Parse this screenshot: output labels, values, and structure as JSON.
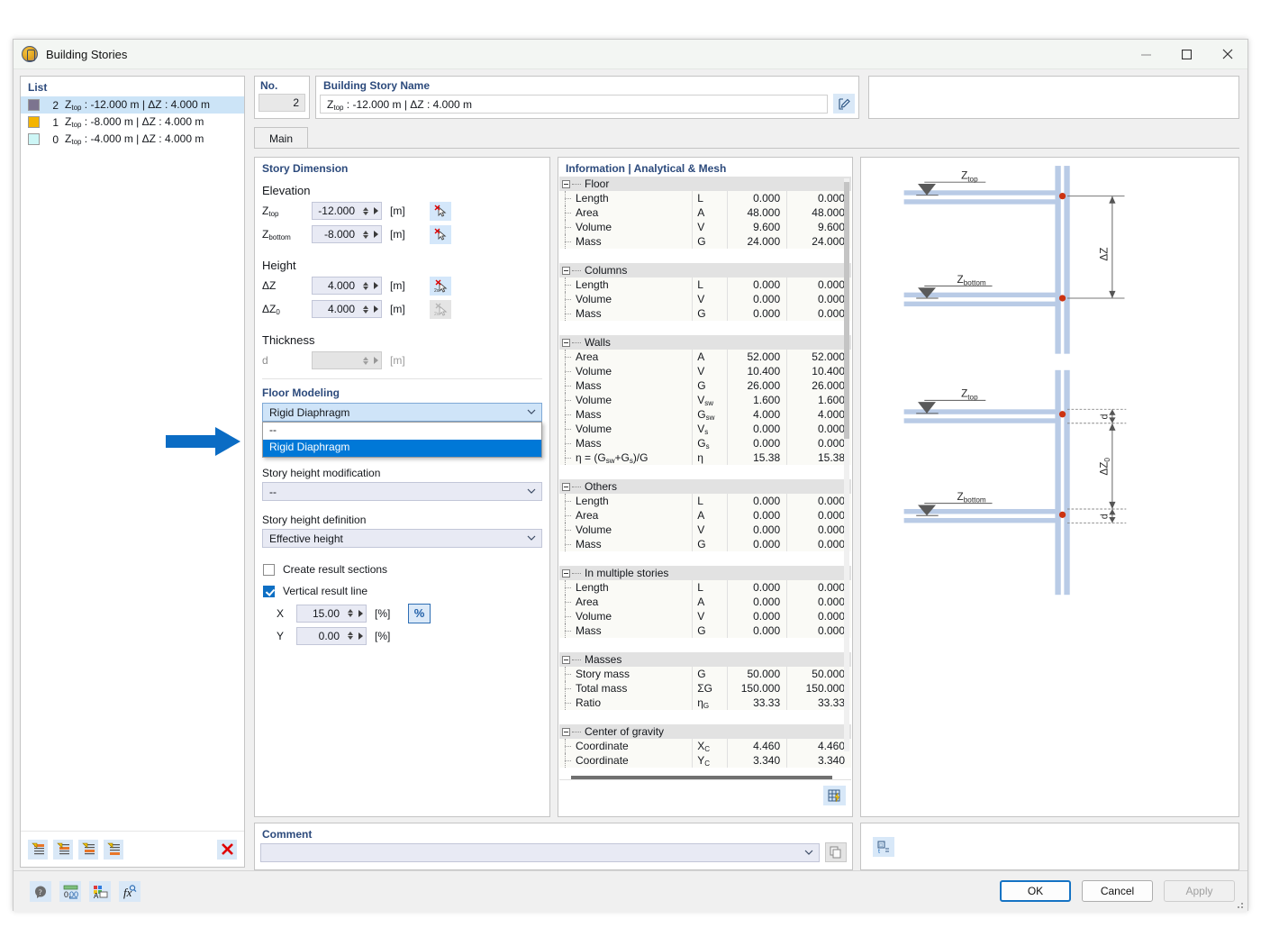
{
  "window": {
    "title": "Building Stories",
    "icon": "building-stories-icon",
    "minimize": "–",
    "maximize": "□",
    "close": "✕"
  },
  "list": {
    "header": "List",
    "items": [
      {
        "color": "#7c748f",
        "num": "2",
        "text": "Ztop : -12.000 m | ΔZ : 4.000 m",
        "selected": true
      },
      {
        "color": "#f4b400",
        "num": "1",
        "text": "Ztop : -8.000 m | ΔZ : 4.000 m",
        "selected": false
      },
      {
        "color": "#cdf6f6",
        "num": "0",
        "text": "Ztop : -4.000 m | ΔZ : 4.000 m",
        "selected": false
      }
    ],
    "toolbar": [
      {
        "name": "insert-story-above-icon"
      },
      {
        "name": "insert-story-below-icon"
      },
      {
        "name": "insert-story-middle-icon"
      },
      {
        "name": "insert-story-bottom-icon"
      },
      {
        "name": "delete-icon"
      }
    ]
  },
  "header": {
    "no_label": "No.",
    "no_value": "2",
    "name_label": "Building Story Name",
    "name_value": "Ztop : -12.000 m | ΔZ : 4.000 m",
    "edit_icon": "edit-pencil-icon"
  },
  "tabs": [
    {
      "label": "Main",
      "active": true
    }
  ],
  "story_dimension": {
    "title": "Story Dimension",
    "elevation_label": "Elevation",
    "height_label": "Height",
    "thickness_label": "Thickness",
    "fields": [
      {
        "name": "Ztop",
        "sub": "top",
        "value": "-12.000",
        "unit": "[m]",
        "enabled": true,
        "pick": "pick-point-icon"
      },
      {
        "name": "Zbottom",
        "sub": "bottom",
        "value": "-8.000",
        "unit": "[m]",
        "enabled": true,
        "pick": "pick-point-icon"
      },
      {
        "name": "ΔZ",
        "sub": "",
        "value": "4.000",
        "unit": "[m]",
        "enabled": true,
        "pick": "pick-distance-icon"
      },
      {
        "name": "ΔZ0",
        "sub": "0",
        "value": "4.000",
        "unit": "[m]",
        "enabled": true,
        "pick": "pick-distance-icon-disabled"
      },
      {
        "name": "d",
        "sub": "",
        "value": "",
        "unit": "[m]",
        "enabled": false,
        "pick": ""
      }
    ]
  },
  "floor_modeling": {
    "title": "Floor Modeling",
    "type_value": "Rigid Diaphragm",
    "dropdown_open": true,
    "dropdown_options": [
      "--",
      "Rigid Diaphragm"
    ],
    "dropdown_selected": "Rigid Diaphragm",
    "height_mod_label": "Story height modification",
    "height_mod_value": "--",
    "height_def_label": "Story height definition",
    "height_def_value": "Effective height",
    "create_result_sections": {
      "label": "Create result sections",
      "checked": false
    },
    "vertical_result_line": {
      "label": "Vertical result line",
      "checked": true
    },
    "x": {
      "name": "X",
      "value": "15.00",
      "unit": "[%]"
    },
    "y": {
      "name": "Y",
      "value": "0.00",
      "unit": "[%]"
    },
    "percent_button": "%"
  },
  "information": {
    "title": "Information | Analytical & Mesh",
    "table_button_icon": "export-table-icon",
    "groups": [
      {
        "name": "Floor",
        "rows": [
          {
            "label": "Length",
            "symbol": "L",
            "sym_sub": "",
            "v1": "0.000",
            "v2": "0.000"
          },
          {
            "label": "Area",
            "symbol": "A",
            "sym_sub": "",
            "v1": "48.000",
            "v2": "48.000"
          },
          {
            "label": "Volume",
            "symbol": "V",
            "sym_sub": "",
            "v1": "9.600",
            "v2": "9.600"
          },
          {
            "label": "Mass",
            "symbol": "G",
            "sym_sub": "",
            "v1": "24.000",
            "v2": "24.000"
          }
        ]
      },
      {
        "name": "Columns",
        "rows": [
          {
            "label": "Length",
            "symbol": "L",
            "sym_sub": "",
            "v1": "0.000",
            "v2": "0.000"
          },
          {
            "label": "Volume",
            "symbol": "V",
            "sym_sub": "",
            "v1": "0.000",
            "v2": "0.000"
          },
          {
            "label": "Mass",
            "symbol": "G",
            "sym_sub": "",
            "v1": "0.000",
            "v2": "0.000"
          }
        ]
      },
      {
        "name": "Walls",
        "rows": [
          {
            "label": "Area",
            "symbol": "A",
            "sym_sub": "",
            "v1": "52.000",
            "v2": "52.000"
          },
          {
            "label": "Volume",
            "symbol": "V",
            "sym_sub": "",
            "v1": "10.400",
            "v2": "10.400"
          },
          {
            "label": "Mass",
            "symbol": "G",
            "sym_sub": "",
            "v1": "26.000",
            "v2": "26.000"
          },
          {
            "label": "Volume",
            "symbol": "V",
            "sym_sub": "sw",
            "v1": "1.600",
            "v2": "1.600"
          },
          {
            "label": "Mass",
            "symbol": "G",
            "sym_sub": "sw",
            "v1": "4.000",
            "v2": "4.000"
          },
          {
            "label": "Volume",
            "symbol": "V",
            "sym_sub": "s",
            "v1": "0.000",
            "v2": "0.000"
          },
          {
            "label": "Mass",
            "symbol": "G",
            "sym_sub": "s",
            "v1": "0.000",
            "v2": "0.000"
          },
          {
            "label": "η = (Gsw+Gs)/G",
            "symbol": "η",
            "sym_sub": "",
            "v1": "15.38",
            "v2": "15.38"
          }
        ]
      },
      {
        "name": "Others",
        "rows": [
          {
            "label": "Length",
            "symbol": "L",
            "sym_sub": "",
            "v1": "0.000",
            "v2": "0.000"
          },
          {
            "label": "Area",
            "symbol": "A",
            "sym_sub": "",
            "v1": "0.000",
            "v2": "0.000"
          },
          {
            "label": "Volume",
            "symbol": "V",
            "sym_sub": "",
            "v1": "0.000",
            "v2": "0.000"
          },
          {
            "label": "Mass",
            "symbol": "G",
            "sym_sub": "",
            "v1": "0.000",
            "v2": "0.000"
          }
        ]
      },
      {
        "name": "In multiple stories",
        "rows": [
          {
            "label": "Length",
            "symbol": "L",
            "sym_sub": "",
            "v1": "0.000",
            "v2": "0.000"
          },
          {
            "label": "Area",
            "symbol": "A",
            "sym_sub": "",
            "v1": "0.000",
            "v2": "0.000"
          },
          {
            "label": "Volume",
            "symbol": "V",
            "sym_sub": "",
            "v1": "0.000",
            "v2": "0.000"
          },
          {
            "label": "Mass",
            "symbol": "G",
            "sym_sub": "",
            "v1": "0.000",
            "v2": "0.000"
          }
        ]
      },
      {
        "name": "Masses",
        "rows": [
          {
            "label": "Story mass",
            "symbol": "G",
            "sym_sub": "",
            "v1": "50.000",
            "v2": "50.000"
          },
          {
            "label": "Total mass",
            "symbol": "ΣG",
            "sym_sub": "",
            "v1": "150.000",
            "v2": "150.000"
          },
          {
            "label": "Ratio",
            "symbol": "η",
            "sym_sub": "G",
            "v1": "33.33",
            "v2": "33.33"
          }
        ]
      },
      {
        "name": "Center of gravity",
        "rows": [
          {
            "label": "Coordinate",
            "symbol": "X",
            "sym_sub": "C",
            "v1": "4.460",
            "v2": "4.460"
          },
          {
            "label": "Coordinate",
            "symbol": "Y",
            "sym_sub": "C",
            "v1": "3.340",
            "v2": "3.340"
          }
        ]
      }
    ]
  },
  "diagram": {
    "top": {
      "ztop_label": "Ztop",
      "zbottom_label": "Zbottom",
      "dim_label": "ΔZ"
    },
    "bottom": {
      "ztop_label": "Ztop",
      "zbottom_label": "Zbottom",
      "dim_label": "ΔZ0",
      "thickness_label_top": "d",
      "thickness_label_bottom": "d"
    }
  },
  "comment": {
    "title": "Comment",
    "value": "",
    "copy_icon": "copy-icon",
    "side_icon": "units-icon"
  },
  "footer": {
    "icons": [
      {
        "name": "help-icon"
      },
      {
        "name": "decimal-places-icon"
      },
      {
        "name": "display-properties-icon"
      },
      {
        "name": "parameters-icon"
      }
    ],
    "buttons": [
      {
        "label": "OK",
        "style": "primary"
      },
      {
        "label": "Cancel",
        "style": "normal"
      },
      {
        "label": "Apply",
        "style": "disabled"
      }
    ]
  },
  "annotation": {
    "arrow_color": "#0b6cc4"
  }
}
